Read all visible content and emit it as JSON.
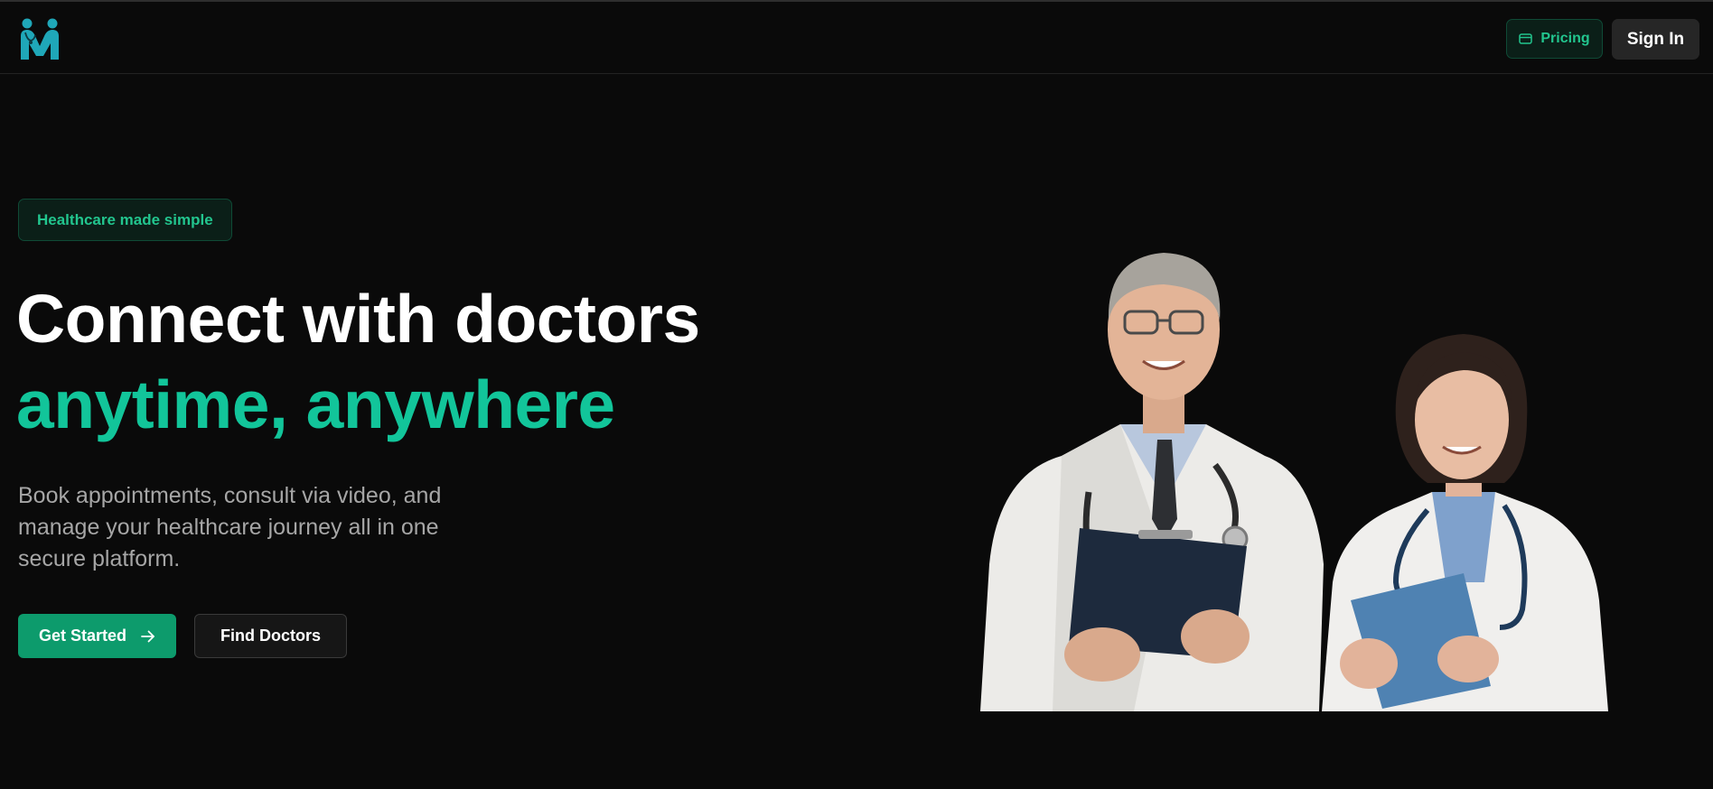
{
  "header": {
    "logo": "medimeet-logo",
    "pricing_label": "Pricing",
    "pricing_icon": "credit-card-icon",
    "signin_label": "Sign In"
  },
  "hero": {
    "badge": "Healthcare made simple",
    "headline_line1": "Connect with doctors",
    "headline_line2": "anytime, anywhere",
    "description": "Book appointments, consult via video, and manage your healthcare journey all in one secure platform.",
    "get_started_label": "Get Started",
    "get_started_icon": "arrow-right-icon",
    "find_doctors_label": "Find Doctors",
    "image": "two-doctors-illustration"
  },
  "colors": {
    "background": "#0a0a0a",
    "accent": "#12c59a",
    "primary_button": "#0d9b6c",
    "badge_text": "#22c58e"
  }
}
